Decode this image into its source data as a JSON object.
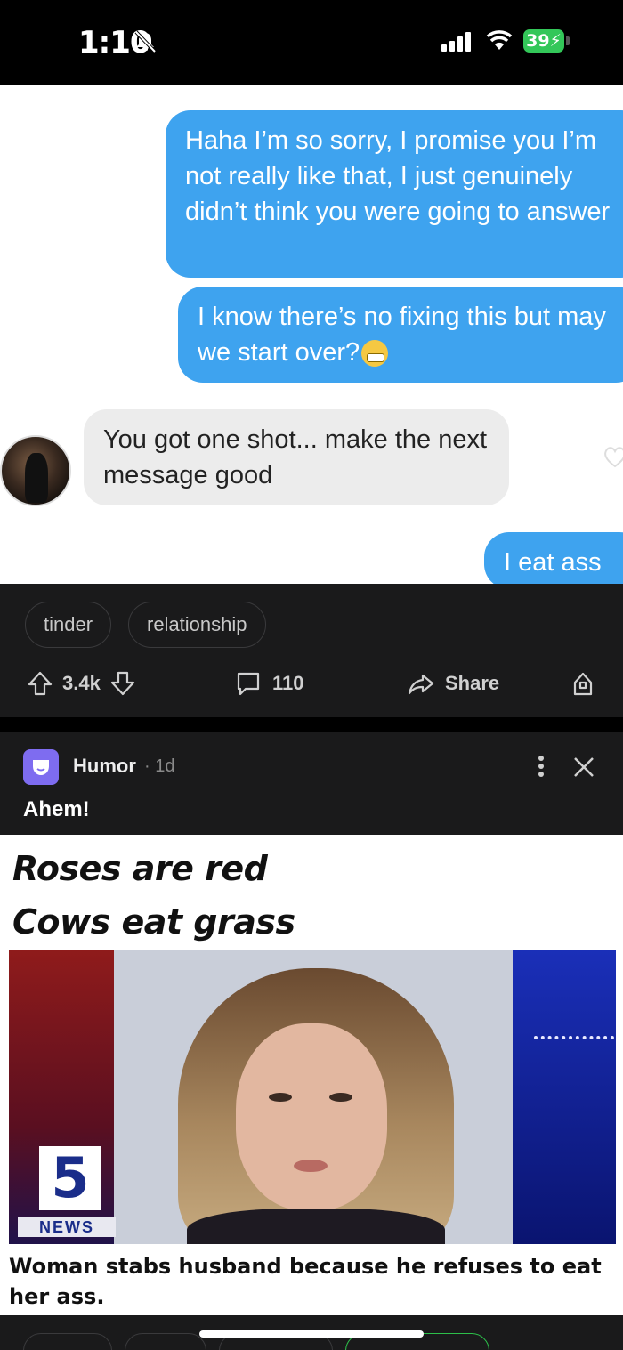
{
  "status_bar": {
    "time": "1:10",
    "battery": "39"
  },
  "chat": {
    "messages": [
      {
        "side": "sent",
        "text": "Haha I’m so sorry, I promise you I’m not really like that, I just genuinely didn’t think you were going to answer"
      },
      {
        "side": "sent",
        "text": "I know there’s no fixing this but may we start over?"
      },
      {
        "side": "received",
        "text": "You got one shot... make the next message good"
      },
      {
        "side": "sent",
        "text": "I eat ass"
      }
    ]
  },
  "post": {
    "tags": [
      "tinder",
      "relationship"
    ],
    "votes": "3.4k",
    "comments": "110",
    "share_label": "Share"
  },
  "next_post": {
    "community": "Humor",
    "age": "· 1d",
    "title": "Ahem!",
    "meme": {
      "line1": "Roses are red",
      "line2": "Cows eat grass",
      "news_number": "5",
      "news_label": "NEWS",
      "caption": "Woman stabs husband because he refuses to eat her ass."
    }
  },
  "colors": {
    "sent_bubble": "#3ea3ef",
    "received_bubble": "#ececec",
    "app_bg": "#1a1a1b",
    "community_icon": "#7e6cf0"
  }
}
